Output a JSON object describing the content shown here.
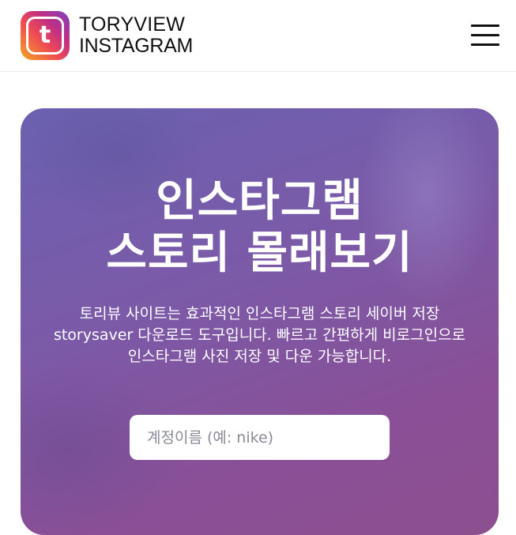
{
  "header": {
    "logo_letter": "t",
    "logo_line1": "TORYVIEW",
    "logo_line2": "INSTAGRAM"
  },
  "hero": {
    "title_line1": "인스타그램",
    "title_line2": "스토리 몰래보기",
    "desc_line1": "토리뷰 사이트는 효과적인 인스타그램 스토리 세이버 저장",
    "desc_line2": "storysaver 다운로드 도구입니다. 빠르고 간편하게 비로그인으로",
    "desc_line3": "인스타그램 사진 저장 및 다운 가능합니다.",
    "search_placeholder": "계정이름 (예: nike)"
  },
  "colors": {
    "hero_top": "#6a61b0",
    "hero_bottom": "#8c4f8f",
    "logo_gradient": [
      "#f5a623",
      "#ee4a54",
      "#c02f86",
      "#7f3fc0"
    ]
  },
  "icons": {
    "logo": "instagram-style-t-icon",
    "menu": "hamburger-menu-icon"
  }
}
